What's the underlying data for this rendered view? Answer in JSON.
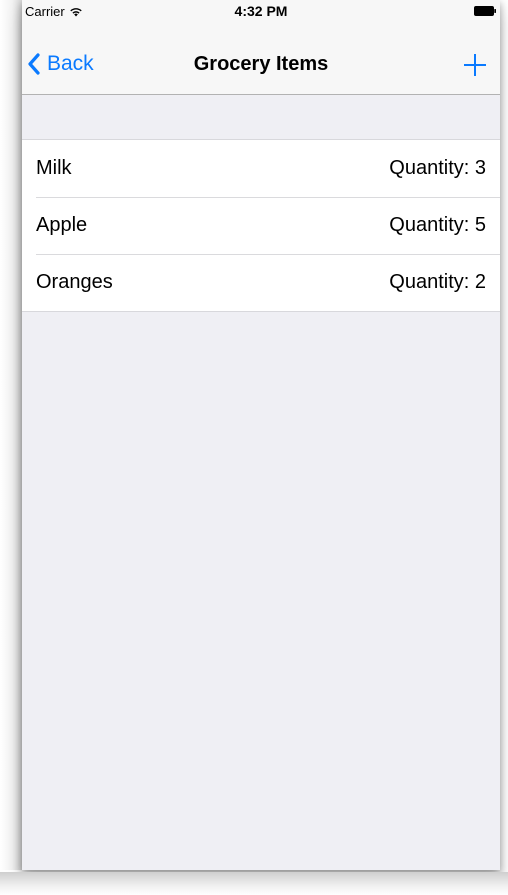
{
  "status_bar": {
    "carrier": "Carrier",
    "time": "4:32 PM",
    "wifi_icon": "wifi-icon",
    "battery_icon": "battery-icon"
  },
  "nav_bar": {
    "back_label": "Back",
    "title": "Grocery Items",
    "add_icon": "plus-icon"
  },
  "items": [
    {
      "name": "Milk",
      "quantity": "Quantity: 3"
    },
    {
      "name": "Apple",
      "quantity": "Quantity: 5"
    },
    {
      "name": "Oranges",
      "quantity": "Quantity: 2"
    }
  ],
  "colors": {
    "accent": "#0a7aff",
    "background": "#efeff4",
    "bar": "#f7f7f7"
  }
}
